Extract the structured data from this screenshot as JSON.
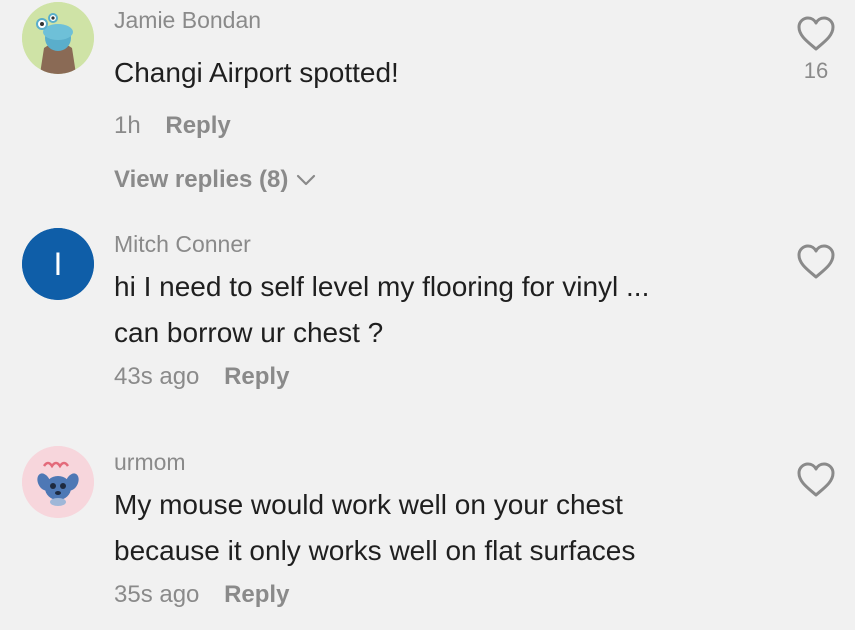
{
  "comments": [
    {
      "username": "Jamie Bondan",
      "text_lines": [
        "Changi Airport spotted!"
      ],
      "time": "1h",
      "reply_label": "Reply",
      "view_replies": "View replies (8)",
      "likes": "16",
      "avatar_icon": "green-alien-character-avatar",
      "avatar_bg": "#cfe3a6"
    },
    {
      "username": "Mitch Conner",
      "text_lines": [
        "hi I need to self level my flooring for vinyl ...",
        "can borrow ur chest ?"
      ],
      "time": "43s ago",
      "reply_label": "Reply",
      "likes": "",
      "avatar_letter": "I",
      "avatar_bg": "#0f5ea8"
    },
    {
      "username": "urmom",
      "text_lines": [
        "My mouse would work well on your chest",
        "because it only works well on flat surfaces"
      ],
      "time": "35s ago",
      "reply_label": "Reply",
      "likes": "",
      "avatar_icon": "stitch-character-avatar",
      "avatar_bg": "#f7d6dc"
    }
  ],
  "colors": {
    "background": "#f1f1f1",
    "secondary_text": "#8a8a8a",
    "primary_text": "#1f1f1f"
  }
}
